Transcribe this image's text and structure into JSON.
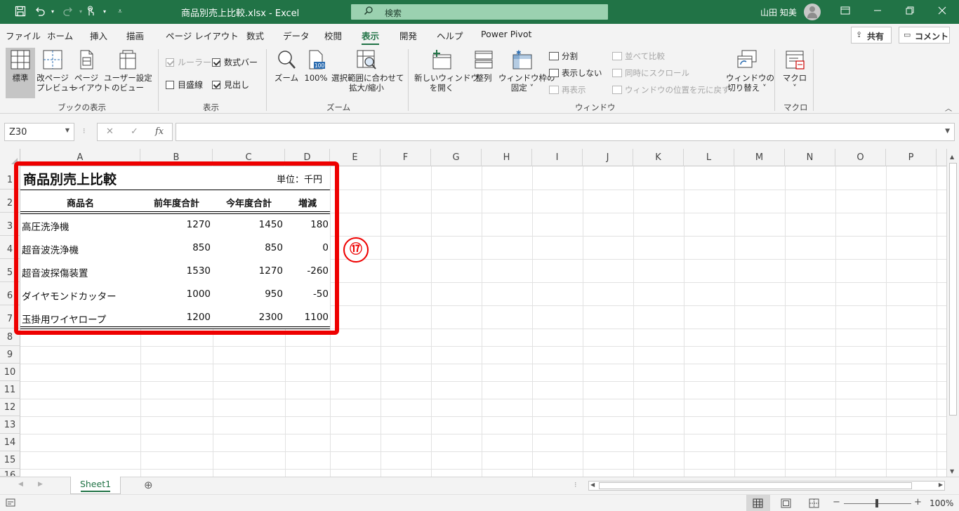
{
  "titlebar": {
    "save_icon": "save-icon",
    "undo_icon": "undo-icon",
    "redo_icon": "redo-icon",
    "touch_icon": "touch-mode-icon",
    "title": "商品別売上比較.xlsx  -  Excel",
    "search_placeholder": "検索",
    "user_name": "山田 知美",
    "bg_color": "#217346"
  },
  "menu": {
    "tabs": [
      "ファイル",
      "ホーム",
      "挿入",
      "描画",
      "ページ レイアウト",
      "数式",
      "データ",
      "校閲",
      "表示",
      "開発",
      "ヘルプ",
      "Power Pivot"
    ],
    "active_tab": "表示",
    "share_label": "共有",
    "comment_label": "コメント"
  },
  "ribbon": {
    "book_view": {
      "label": "ブックの表示",
      "normal": "標準",
      "page_break_preview": [
        "改ページ",
        "プレビュー"
      ],
      "page_layout": [
        "ページ",
        "レイアウト"
      ],
      "custom_views": [
        "ユーザー設定",
        "のビュー"
      ]
    },
    "show": {
      "label": "表示",
      "ruler": "ルーラー",
      "formula_bar": "数式バー",
      "gridlines": "目盛線",
      "headings": "見出し"
    },
    "zoom": {
      "label": "ズーム",
      "zoom": "ズーム",
      "hundred": "100%",
      "zoom_to_selection": [
        "選択範囲に合わせて",
        "拡大/縮小"
      ]
    },
    "window": {
      "label": "ウィンドウ",
      "new_window": [
        "新しいウィンドウ",
        "を開く"
      ],
      "arrange": "整列",
      "freeze_panes": [
        "ウィンドウ枠の",
        "固定"
      ],
      "split": "分割",
      "hide": "表示しない",
      "unhide": "再表示",
      "side_by_side": "並べて比較",
      "sync_scroll": "同時にスクロール",
      "reset_position": "ウィンドウの位置を元に戻す",
      "switch_windows": [
        "ウィンドウの",
        "切り替え"
      ]
    },
    "macros": {
      "label": "マクロ",
      "macros": "マクロ"
    }
  },
  "formula_bar": {
    "name_box": "Z30",
    "cancel": "✕",
    "enter": "✓",
    "fx": "fx",
    "value": ""
  },
  "columns": [
    "A",
    "B",
    "C",
    "D",
    "E",
    "F",
    "G",
    "H",
    "I",
    "J",
    "K",
    "L",
    "M",
    "N",
    "O",
    "P"
  ],
  "rows": [
    "1",
    "2",
    "3",
    "4",
    "5",
    "6",
    "7",
    "8",
    "9",
    "10",
    "11",
    "12",
    "13",
    "14",
    "15",
    "16"
  ],
  "sheet": {
    "title": "商品別売上比較",
    "unit": "単位：千円",
    "headers": [
      "商品名",
      "前年度合計",
      "今年度合計",
      "増減"
    ],
    "data": [
      [
        "高圧洗浄機",
        "1270",
        "1450",
        "180"
      ],
      [
        "超音波洗浄機",
        "850",
        "850",
        "0"
      ],
      [
        "超音波探傷装置",
        "1530",
        "1270",
        "-260"
      ],
      [
        "ダイヤモンドカッター",
        "1000",
        "950",
        "-50"
      ],
      [
        "玉掛用ワイヤロープ",
        "1200",
        "2300",
        "1100"
      ]
    ]
  },
  "annotation": {
    "badge": "⑰",
    "color": "#ee0000"
  },
  "sheet_tabs": {
    "tabs": [
      "Sheet1"
    ],
    "add": "⊕"
  },
  "status": {
    "zoom_minus": "−",
    "zoom_plus": "+",
    "zoom": "100%"
  }
}
